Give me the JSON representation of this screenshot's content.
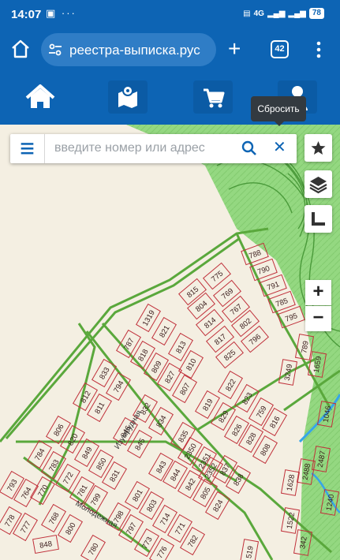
{
  "status_bar": {
    "time": "14:07",
    "network": "4G",
    "battery": "78"
  },
  "browser": {
    "url": "реестра-выписка.рус",
    "tab_count": "42"
  },
  "map_ui": {
    "tooltip": "Сбросить",
    "search_placeholder": "введите номер или адрес",
    "zoom_in": "+",
    "zoom_out": "−"
  },
  "streets": [
    "Изумрудная",
    "Молодежная"
  ],
  "plots": [
    "775",
    "815",
    "769",
    "804",
    "767",
    "814",
    "802",
    "817",
    "796",
    "825",
    "1319",
    "821",
    "787",
    "813",
    "818",
    "809",
    "810",
    "827",
    "807",
    "833",
    "794",
    "812",
    "811",
    "832",
    "834",
    "846",
    "845",
    "835",
    "822",
    "819",
    "823",
    "829",
    "759",
    "826",
    "816",
    "828",
    "808",
    "3249",
    "789",
    "1659",
    "785",
    "795",
    "790",
    "791",
    "788",
    "806",
    "820",
    "784",
    "783",
    "849",
    "772",
    "850",
    "781",
    "831",
    "770",
    "799",
    "764",
    "793",
    "778",
    "777",
    "768",
    "800",
    "848",
    "798",
    "797",
    "801",
    "803",
    "843",
    "844",
    "2350",
    "2351",
    "2352",
    "842",
    "805",
    "837",
    "838",
    "824",
    "714",
    "771",
    "773",
    "776",
    "782",
    "780",
    "519",
    "2487",
    "2488",
    "1628",
    "1046",
    "1240",
    "1522",
    "342"
  ],
  "colors": {
    "header_blue": "#0d64b4",
    "plot_border": "#c0303a",
    "forest_green": "#8fd77c",
    "road_green": "#5aa83c",
    "map_bg": "#f4efe2"
  }
}
